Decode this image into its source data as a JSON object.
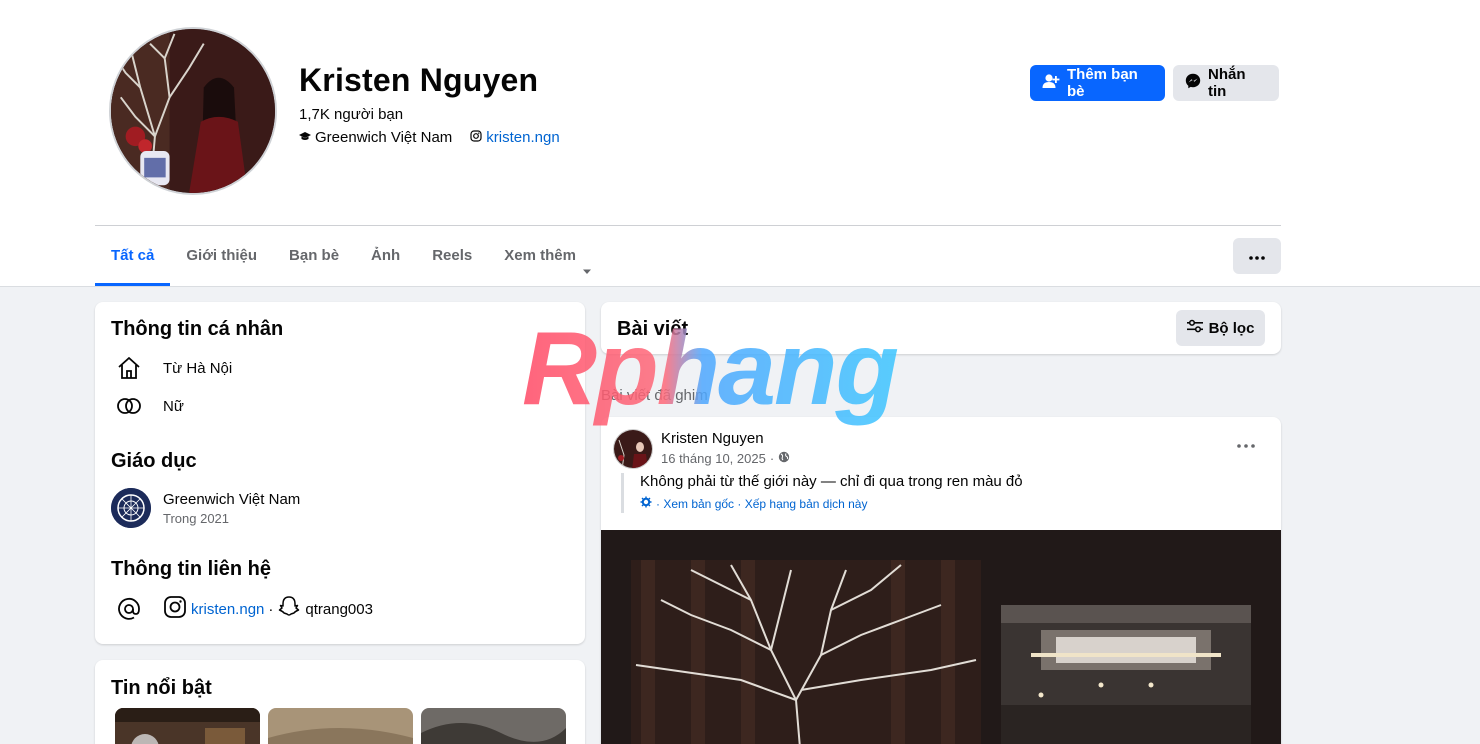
{
  "profile": {
    "name": "Kristen Nguyen",
    "friends_count": "1,7K người bạn",
    "school": "Greenwich Việt Nam",
    "instagram": "kristen.ngn"
  },
  "actions": {
    "add_friend": "Thêm bạn bè",
    "message": "Nhắn tin"
  },
  "tabs": [
    {
      "label": "Tất cả",
      "active": true
    },
    {
      "label": "Giới thiệu"
    },
    {
      "label": "Bạn bè"
    },
    {
      "label": "Ảnh"
    },
    {
      "label": "Reels"
    },
    {
      "label": "Xem thêm"
    }
  ],
  "intro": {
    "title": "Thông tin cá nhân",
    "hometown": "Từ Hà Nội",
    "gender": "Nữ",
    "education_title": "Giáo dục",
    "school_name": "Greenwich Việt Nam",
    "school_year": "Trong 2021",
    "contact_title": "Thông tin liên hệ",
    "contact_instagram": "kristen.ngn",
    "contact_separator": "·",
    "contact_snapchat": "qtrang003"
  },
  "highlights": {
    "title": "Tin nổi bật"
  },
  "posts": {
    "title": "Bài viết",
    "filter_label": "Bộ lọc",
    "pinned_label": "Bài viết đã ghim"
  },
  "post": {
    "author": "Kristen Nguyen",
    "date": "16 tháng 10, 2025",
    "date_separator": "·",
    "text": "Không phải từ thế giới này — chỉ đi qua trong ren màu đỏ",
    "translation_note": "· Xem bản gốc · Xếp hạng bản dịch này"
  },
  "watermark": {
    "text": "Rphang"
  },
  "colors": {
    "primary": "#0866ff",
    "link": "#0064d1",
    "page_bg": "#f0f2f5",
    "secondary_btn": "#e4e6eb"
  }
}
